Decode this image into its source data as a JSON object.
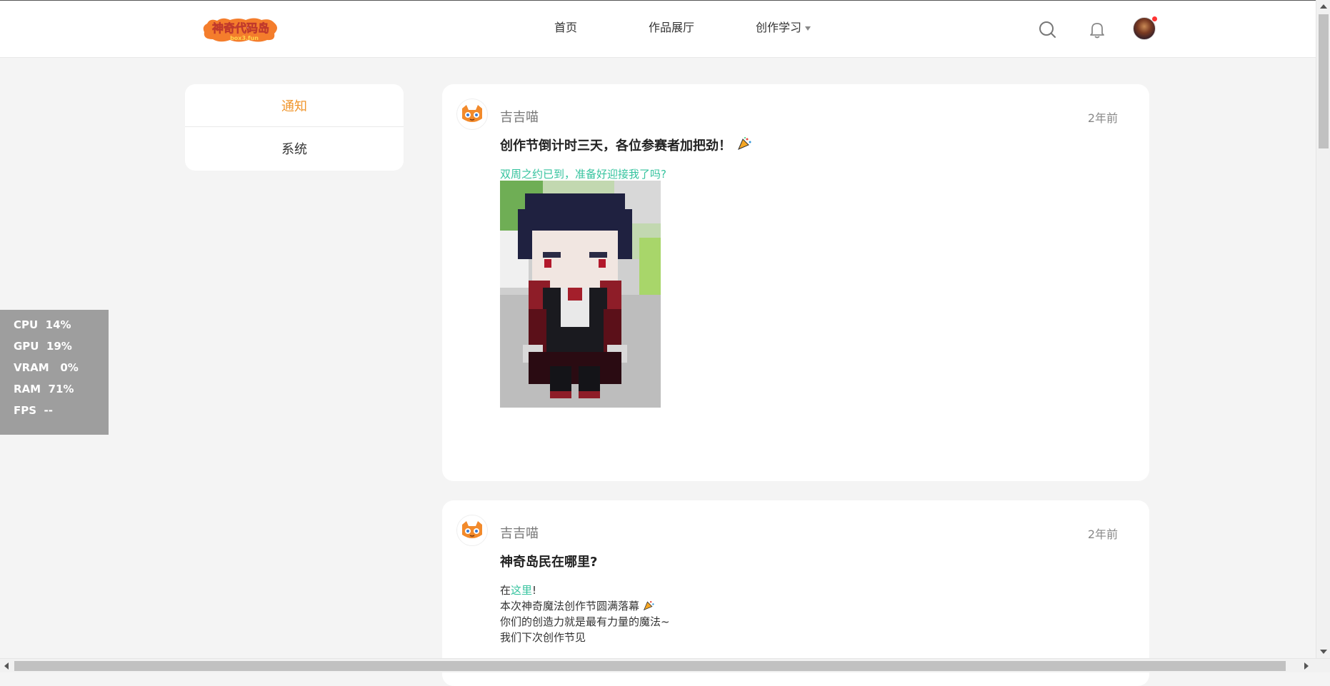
{
  "header": {
    "logo_text": "神奇代码岛",
    "logo_sub": "box3.fun",
    "nav": {
      "home": "首页",
      "gallery": "作品展厅",
      "learn": "创作学习"
    }
  },
  "sidebar": {
    "items": [
      {
        "label": "通知",
        "active": true
      },
      {
        "label": "系统",
        "active": false
      }
    ]
  },
  "notices": [
    {
      "sender": "吉吉喵",
      "time": "2年前",
      "title": "创作节倒计时三天，各位参赛者加把劲！",
      "subtitle": "双周之约已到，准备好迎接我了吗?"
    },
    {
      "sender": "吉吉喵",
      "time": "2年前",
      "title": "神奇岛民在哪里?",
      "line1_prefix": "在",
      "line1_link": "这里",
      "line1_suffix": "!",
      "line2": "本次神奇魔法创作节圆满落幕",
      "line3": "你们的创造力就是最有力量的魔法~",
      "line4": "我们下次创作节见"
    }
  ],
  "perf_overlay": {
    "rows": [
      "CPU  14%",
      "GPU  19%",
      "VRAM   0%",
      "RAM  71%",
      "FPS  --"
    ]
  },
  "colors": {
    "accent_orange": "#f0962e",
    "link_green": "#35c39e",
    "notification_dot": "#ff3333"
  }
}
